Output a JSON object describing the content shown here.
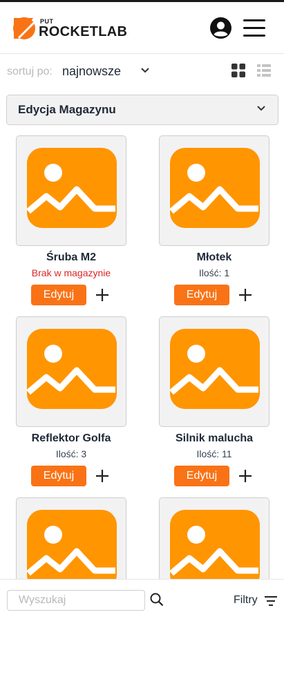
{
  "brand": {
    "put": "PUT",
    "name": "ROCKETLAB",
    "accent": "#f97316"
  },
  "header": {
    "user_icon": "user-circle-icon",
    "menu_icon": "hamburger-icon"
  },
  "sort": {
    "label": "sortuj po:",
    "value": "najnowsze"
  },
  "edition": {
    "label": "Edycja Magazynu"
  },
  "products": [
    {
      "name": "Śruba M2",
      "status": "Brak w magazynie",
      "edit": "Edytuj"
    },
    {
      "name": "Młotek",
      "status": "Ilość: 1",
      "edit": "Edytuj"
    },
    {
      "name": "Reflektor Golfa",
      "status": "Ilość: 3",
      "edit": "Edytuj"
    },
    {
      "name": "Silnik malucha",
      "status": "Ilość: 11",
      "edit": "Edytuj"
    },
    {
      "name": "",
      "status": "",
      "edit": ""
    },
    {
      "name": "",
      "status": "",
      "edit": ""
    }
  ],
  "search": {
    "placeholder": "Wyszukaj"
  },
  "filters": {
    "label": "Filtry"
  }
}
